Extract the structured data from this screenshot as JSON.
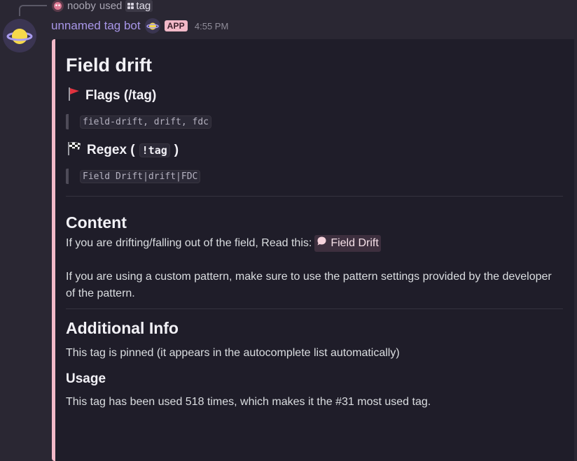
{
  "reply": {
    "user": "nooby",
    "action": "used",
    "command": "tag"
  },
  "message": {
    "author": "unnamed tag bot",
    "badge": "APP",
    "timestamp": "4:55 PM"
  },
  "embed": {
    "title": "Field drift",
    "flags_heading": "Flags (/tag)",
    "flags_value": "field-drift, drift, fdc",
    "regex_heading_prefix": "Regex (",
    "regex_heading_code": "!tag",
    "regex_heading_suffix": ")",
    "regex_value": "Field Drift|drift|FDC",
    "content_heading": "Content",
    "content_line1": "If you are drifting/falling out of the field, Read this:",
    "content_mention": "Field Drift",
    "content_line2": "If you are using a custom pattern, make sure to use the pattern settings provided by the developer of the pattern.",
    "additional_heading": "Additional Info",
    "additional_text": "This tag is pinned (it appears in the autocomplete list automatically)",
    "usage_heading": "Usage",
    "usage_text": "This tag has been used 518 times, which makes it the #31 most used tag."
  },
  "colors": {
    "accent": "#f2b9c8",
    "author": "#a896e8",
    "embed_bg": "#1f1d29",
    "page_bg": "#2a2733"
  }
}
